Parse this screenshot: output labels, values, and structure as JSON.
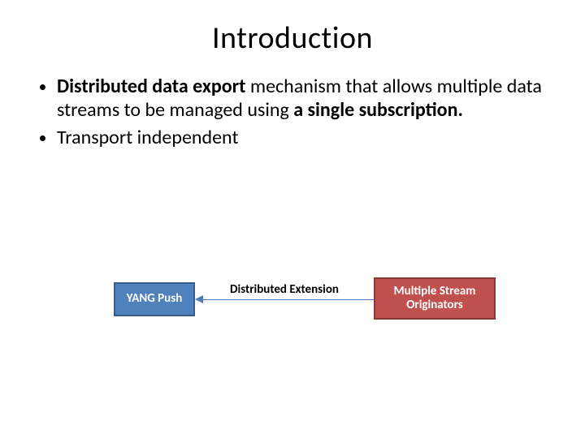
{
  "title": "Introduction",
  "bullets": [
    {
      "segments": [
        {
          "text": "Distributed data export",
          "bold": true
        },
        {
          "text": " mechanism that allows multiple data streams to be managed using ",
          "bold": false
        },
        {
          "text": "a single subscription.",
          "bold": true
        }
      ]
    },
    {
      "segments": [
        {
          "text": "Transport independent",
          "bold": false
        }
      ]
    }
  ],
  "diagram": {
    "left_box": "YANG Push",
    "arrow_label": "Distributed Extension",
    "right_box": "Multiple Stream Originators"
  }
}
